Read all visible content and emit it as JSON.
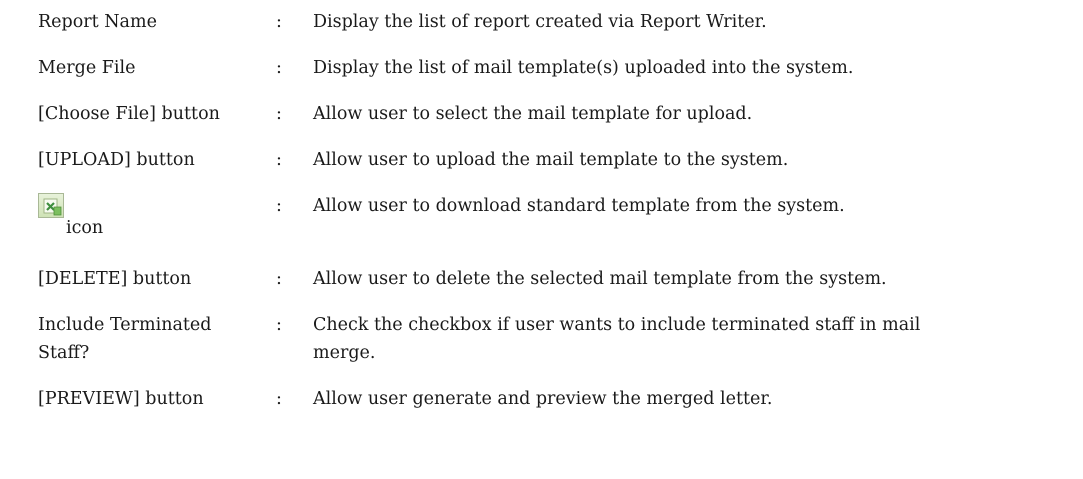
{
  "rows": [
    {
      "term": "Report Name",
      "colon": ":",
      "desc": "Display the list of report created via Report Writer."
    },
    {
      "term": "Merge File",
      "colon": ":",
      "desc": "Display the list of mail template(s) uploaded into the system."
    },
    {
      "term": "[Choose File] button",
      "colon": ":",
      "desc": "Allow user to select the mail template for upload."
    },
    {
      "term": "[UPLOAD] button",
      "colon": ":",
      "desc": "Allow user to upload the mail template to the system."
    },
    {
      "term": "icon",
      "icon": "download-template-icon",
      "colon": ":",
      "desc": "Allow user to download standard template from the system."
    },
    {
      "term": "[DELETE] button",
      "colon": ":",
      "desc": "Allow user to delete the selected mail template from the system."
    },
    {
      "term_line1": "Include Terminated",
      "term_line2": "Staff?",
      "colon": ":",
      "desc_line1": "Check the checkbox if user wants to include terminated staff in mail",
      "desc_line2": "merge."
    },
    {
      "term": "[PREVIEW] button",
      "colon": ":",
      "desc": "Allow user generate and preview the merged letter."
    }
  ]
}
